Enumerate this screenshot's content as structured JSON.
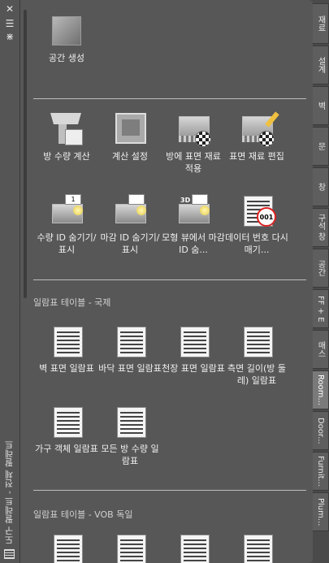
{
  "palette": {
    "title": "도구 팔레트 - 전체 팔레트",
    "controls": {
      "close": "✕",
      "menu": "☰",
      "autohide": "⋇"
    }
  },
  "top_tools": [
    {
      "label": "공간 생성",
      "icon": "space-box-icon"
    }
  ],
  "tools_row1": [
    {
      "label": "방 수량 계산",
      "icon": "funnel-icon"
    },
    {
      "label": "계산 설정",
      "icon": "settings-wrench-icon"
    },
    {
      "label": "방에 표면 재료 적용",
      "icon": "apply-material-icon"
    },
    {
      "label": "표면 재료 편집",
      "icon": "edit-material-icon"
    }
  ],
  "tools_row2": [
    {
      "label": "수량 ID 숨기기/표시",
      "icon": "quantity-id-icon",
      "flag": "1"
    },
    {
      "label": "마감 ID 숨기기/표시",
      "icon": "finish-id-icon",
      "flag": ""
    },
    {
      "label": "모형 뷰에서 마감 ID 숨...",
      "icon": "model-view-id-icon",
      "flag": "3D"
    },
    {
      "label": "데이터 번호 다시 매기...",
      "icon": "renumber-icon",
      "badge": "001"
    }
  ],
  "section_international": {
    "title": "일람표 테이블 - 국제",
    "items": [
      {
        "label": "벽 표면 일람표"
      },
      {
        "label": "바닥 표면 일람표"
      },
      {
        "label": "천장 표면 일람표"
      },
      {
        "label": "측면 길이(방 둘레) 일람표"
      },
      {
        "label": "가구 객체 일람표"
      },
      {
        "label": "모든 방 수량 일람표"
      }
    ]
  },
  "section_vob": {
    "title": "일람표 테이블 - VOB 독일"
  },
  "tabs": [
    {
      "label": "재료"
    },
    {
      "label": "설계"
    },
    {
      "label": "벽"
    },
    {
      "label": "문"
    },
    {
      "label": "창"
    },
    {
      "label": "구석 창"
    },
    {
      "label": "공간"
    },
    {
      "label": "FF + E"
    },
    {
      "label": "매스"
    },
    {
      "label": "Room...",
      "active": true
    },
    {
      "label": "Door..."
    },
    {
      "label": "Furnit..."
    },
    {
      "label": "Plum..."
    }
  ]
}
